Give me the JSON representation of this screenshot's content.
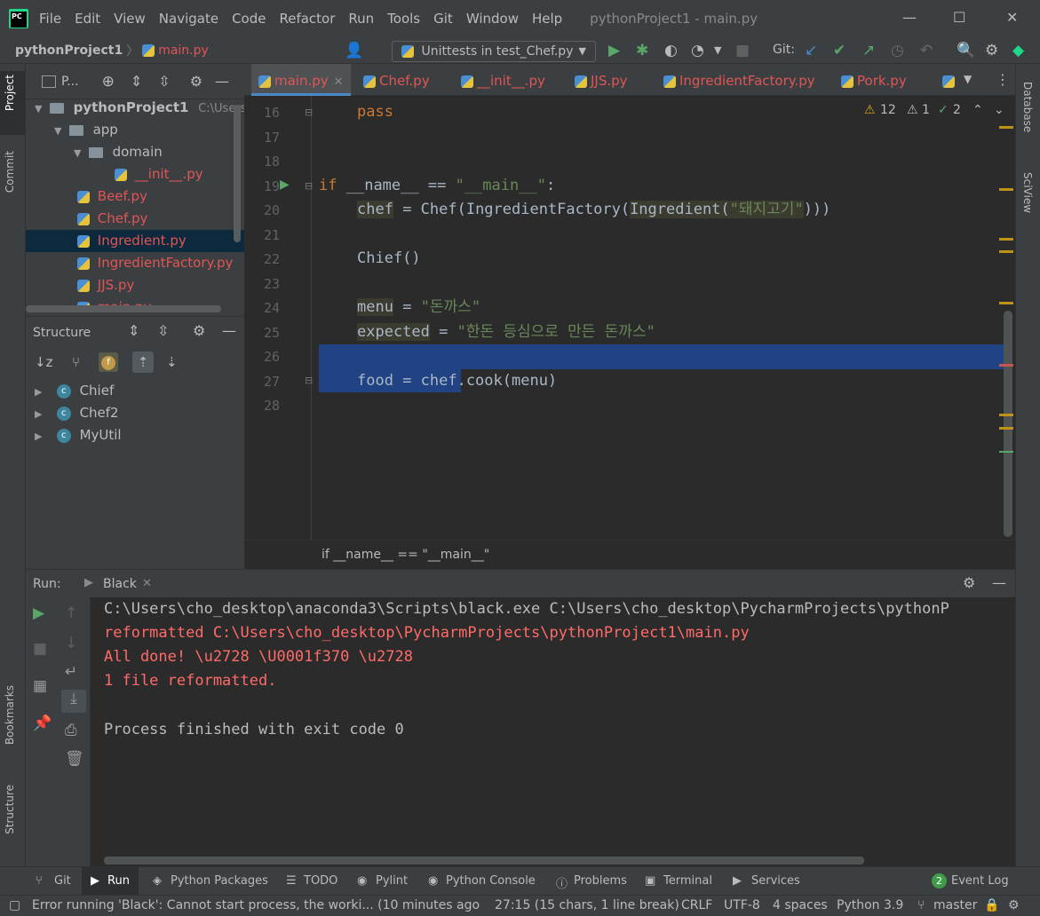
{
  "window": {
    "menu": [
      "File",
      "Edit",
      "View",
      "Navigate",
      "Code",
      "Refactor",
      "Run",
      "Tools",
      "Git",
      "Window",
      "Help"
    ],
    "title": "pythonProject1 - main.py",
    "minimize": "—",
    "maximize": "☐",
    "close": "✕"
  },
  "navbar": {
    "project": "pythonProject1",
    "sep": "〉",
    "file": "main.py",
    "run_config": "Unittests in test_Chef.py",
    "git_label": "Git:"
  },
  "left_stripe": {
    "project": "Project",
    "commit": "Commit",
    "bookmarks": "Bookmarks",
    "structure": "Structure"
  },
  "right_stripe": {
    "database": "Database",
    "sciview": "SciView"
  },
  "project_panel": {
    "title": "P...",
    "root": "pythonProject1",
    "root_path": "C:\\Users\\c",
    "items": [
      "app",
      "domain",
      "__init__.py",
      "Beef.py",
      "Chef.py",
      "Ingredient.py",
      "IngredientFactory.py",
      "JJS.py",
      "main.py"
    ]
  },
  "structure_panel": {
    "title": "Structure",
    "classes": [
      "Chief",
      "Chef2",
      "MyUtil"
    ]
  },
  "editor": {
    "tabs": [
      "main.py",
      "Chef.py",
      "__init__.py",
      "JJS.py",
      "IngredientFactory.py",
      "Pork.py"
    ],
    "warnings": "12",
    "weak_warnings": "1",
    "typos": "2",
    "line_numbers": [
      "16",
      "17",
      "18",
      "19",
      "20",
      "21",
      "22",
      "23",
      "24",
      "25",
      "26",
      "27",
      "28"
    ],
    "code": {
      "l16_kw": "pass",
      "l19_if": "if",
      "l19_name": "__name__",
      "l19_eq": " == ",
      "l19_str": "\"__main__\"",
      "l19_colon": ":",
      "l20_var": "chef",
      "l20_mid": " = Chef(IngredientFactory(",
      "l20_ing": "Ingredient(",
      "l20_str": "\"돼지고기\"",
      "l20_end": ")))",
      "l22": "Chief()",
      "l24_var": "menu",
      "l24_eq": " = ",
      "l24_str": "\"돈까스\"",
      "l25_var": "expected",
      "l25_eq": " = ",
      "l25_str": "\"한돈 등심으로 만든 돈까스\"",
      "l27": "food = chef.cook(menu)"
    },
    "breadcrumb": "if __name__ == \"__main__\""
  },
  "run_panel": {
    "label": "Run:",
    "tab": "Black",
    "console": [
      "C:\\Users\\cho_desktop\\anaconda3\\Scripts\\black.exe C:\\Users\\cho_desktop\\PycharmProjects\\pythonP",
      "reformatted C:\\Users\\cho_desktop\\PycharmProjects\\pythonProject1\\main.py",
      "All done! \\u2728 \\U0001f370 \\u2728",
      "1 file reformatted.",
      "Process finished with exit code 0"
    ]
  },
  "bottom_tools": [
    "Git",
    "Run",
    "Python Packages",
    "TODO",
    "Pylint",
    "Python Console",
    "Problems",
    "Terminal",
    "Services"
  ],
  "event_log": {
    "count": "2",
    "label": "Event Log"
  },
  "status": {
    "message": "Error running 'Black': Cannot start process, the worki... (10 minutes ago",
    "position": "27:15 (15 chars, 1 line break)",
    "line_sep": "CRLF",
    "encoding": "UTF-8",
    "indent": "4 spaces",
    "interpreter": "Python 3.9",
    "branch": "master"
  },
  "colors": {
    "accent": "#4a88c7",
    "error_red": "#ff6b68",
    "file_red": "#e05555",
    "selection": "#214283",
    "run_green": "#59a869"
  }
}
